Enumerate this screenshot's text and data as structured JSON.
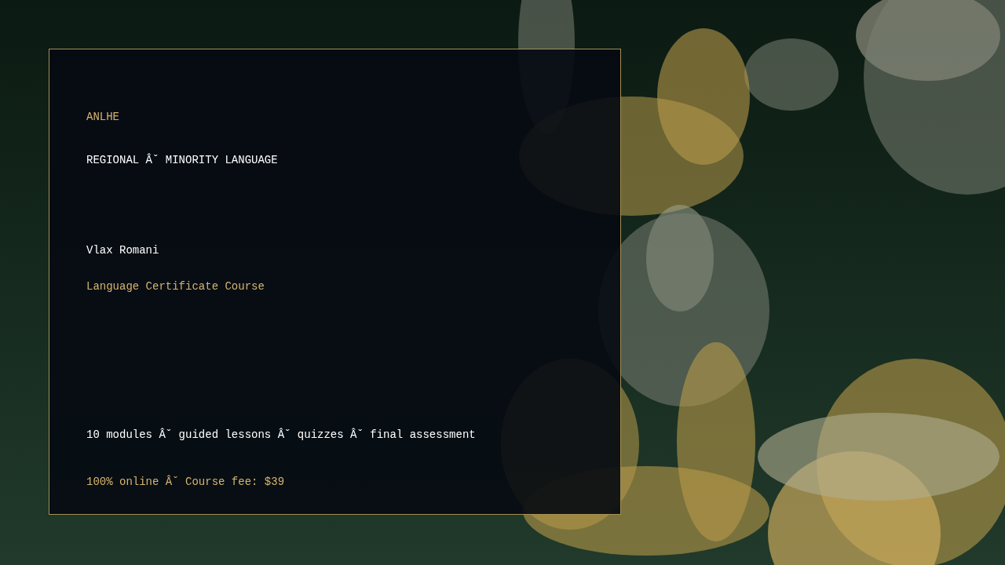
{
  "card": {
    "brand": "ANLHE",
    "category": "REGIONAL Âˇ MINORITY LANGUAGE",
    "language": "Vlax Romani",
    "course_type": "Language Certificate Course",
    "details": "10 modules Âˇ guided lessons Âˇ quizzes Âˇ final assessment",
    "pricing": "100% online Âˇ Course fee: $39"
  }
}
